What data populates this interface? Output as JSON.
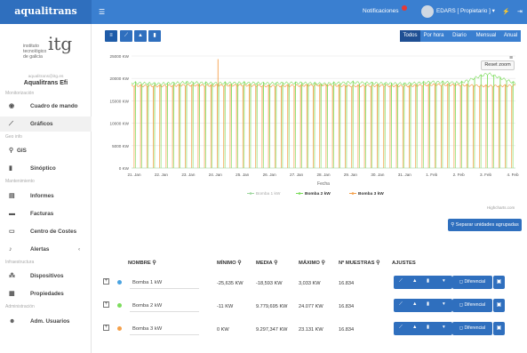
{
  "app": {
    "brand": "aqualitrans"
  },
  "topbar": {
    "menu_icon": "hamburger-icon",
    "notifications_label": "Notificaciones",
    "user_label": "EDARS [ Propietario ] ▾",
    "extra_icon_1": "bolt-icon",
    "extra_icon_2": "logout-icon"
  },
  "sidebar": {
    "logo_lines": [
      "instituto",
      "tecnológico",
      "de galicia"
    ],
    "logo_mark": "itg",
    "user_email": "aqualitrans@itg.es",
    "user_name": "Aqualitrans Efi",
    "sections": {
      "monitoring": "Monitorización",
      "gis": "Geo info",
      "maintenance": "Mantenimiento",
      "infra": "Infraestructura",
      "admin": "Administración"
    },
    "items": [
      {
        "label": "Cuadro de mando",
        "icon": "dashboard-icon"
      },
      {
        "label": "Gráficos",
        "icon": "line-chart-icon"
      },
      {
        "label": "GIS",
        "icon": "map-pin-icon"
      },
      {
        "label": "Sinóptico",
        "icon": "book-icon"
      },
      {
        "label": "Informes",
        "icon": "table-icon"
      },
      {
        "label": "Facturas",
        "icon": "invoice-icon"
      },
      {
        "label": "Centro de Costes",
        "icon": "cost-icon"
      },
      {
        "label": "Alertas",
        "icon": "bell-icon"
      },
      {
        "label": "Dispositivos",
        "icon": "sitemap-icon"
      },
      {
        "label": "Propiedades",
        "icon": "building-icon"
      },
      {
        "label": "Adm. Usuarios",
        "icon": "users-icon"
      }
    ]
  },
  "toolbar": {
    "chart_buttons": [
      "list-icon",
      "line-chart-icon",
      "bar-chart-icon",
      "column-chart-icon"
    ],
    "period_tabs": [
      "Todos",
      "Por hora",
      "Diario",
      "Mensual",
      "Anual"
    ],
    "active_tab": "Todos"
  },
  "chart_controls": {
    "reset_zoom": "Reset zoom",
    "menu_icon": "hamburger-icon",
    "credits": "Highcharts.com",
    "separate_button": "Separar unidades agrupadas"
  },
  "chart_data": {
    "type": "line",
    "xlabel": "Fecha",
    "ylabel": "",
    "x_tick_labels": [
      "21. Jan",
      "22. Jan",
      "23. Jan",
      "24. Jan",
      "25. Jan",
      "26. Jan",
      "27. Jan",
      "28. Jan",
      "29. Jan",
      "30. Jan",
      "31. Jan",
      "1. Feb",
      "2. Feb",
      "3. Feb",
      "4. Feb"
    ],
    "y_tick_labels": [
      "0 KW",
      "5000 KW",
      "10000 KW",
      "15000 KW",
      "20000 KW",
      "25000 KW"
    ],
    "ylim": [
      0,
      25000
    ],
    "grid": true,
    "legend_position": "bottom",
    "series": [
      {
        "name": "Bomba 1 kW",
        "color": "#9fd79f",
        "values": [
          0,
          0,
          0,
          0,
          0,
          0,
          0,
          0,
          0,
          0,
          0,
          0,
          0,
          0,
          0
        ]
      },
      {
        "name": "Bomba 2 kW",
        "color": "#7cdc5c",
        "values": [
          19000,
          18800,
          19100,
          18900,
          19000,
          18900,
          19000,
          18800,
          19100,
          18900,
          18800,
          19200,
          19000,
          21100,
          18900
        ]
      },
      {
        "name": "Bomba 3 kW",
        "color": "#f5a04a",
        "values": [
          18400,
          18300,
          18500,
          18400,
          18500,
          18300,
          18400,
          18500,
          18300,
          18400,
          18300,
          18600,
          18500,
          18300,
          18400
        ]
      }
    ],
    "annotations": {
      "spike_value": 24300,
      "spike_label_day": "24. Jan"
    }
  },
  "table": {
    "headers": [
      "NOMBRE",
      "MÍNIMO",
      "MEDIA",
      "MÁXIMO",
      "Nº MUESTRAS",
      "AJUSTES"
    ],
    "search_icon": "search-icon",
    "rows": [
      {
        "name": "Bomba 1 kW",
        "color": "#4aa3e0",
        "min": "-25,635 KW",
        "mean": "-18,593 KW",
        "max": "3,033 KW",
        "samples": "16.834"
      },
      {
        "name": "Bomba 2 kW",
        "color": "#7cdc5c",
        "min": "-11 KW",
        "mean": "9.779,695 KW",
        "max": "24.077 KW",
        "samples": "16.834"
      },
      {
        "name": "Bomba 3 kW",
        "color": "#f5a04a",
        "min": "0 KW",
        "mean": "9.297,347 KW",
        "max": "23.131 KW",
        "samples": "16.834"
      }
    ],
    "row_actions": {
      "diff_label": "Diferencial",
      "export_icon": "excel-icon"
    }
  }
}
